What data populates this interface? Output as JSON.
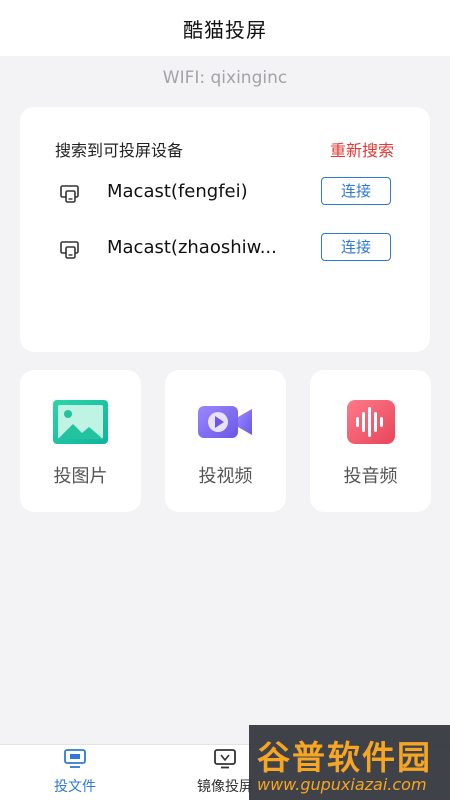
{
  "header": {
    "title": "酷猫投屏"
  },
  "wifi": {
    "label": "WIFI: qixinginc"
  },
  "devices": {
    "heading": "搜索到可投屏设备",
    "research_label": "重新搜索",
    "items": [
      {
        "name": "Macast(fengfei)",
        "button": "连接",
        "icon": "cast-screen-icon"
      },
      {
        "name": "Macast(zhaoshiw...",
        "button": "连接",
        "icon": "cast-screen-icon"
      }
    ]
  },
  "features": [
    {
      "label": "投图片",
      "icon": "image-icon",
      "color": "#1ec8a5"
    },
    {
      "label": "投视频",
      "icon": "video-camera-icon",
      "color": "#7b6cf0"
    },
    {
      "label": "投音频",
      "icon": "audio-wave-icon",
      "color": "#f0566a"
    }
  ],
  "tabs": [
    {
      "label": "投文件",
      "icon": "cast-file-icon",
      "active": true
    },
    {
      "label": "镜像投屏",
      "icon": "tv-mirror-icon",
      "active": false
    }
  ],
  "watermark": {
    "text": "谷普软件园",
    "url": "www.gupuxiazai.com"
  },
  "colors": {
    "accent_blue": "#2f79d6",
    "research_red": "#e53935",
    "background": "#f3f3f5"
  }
}
